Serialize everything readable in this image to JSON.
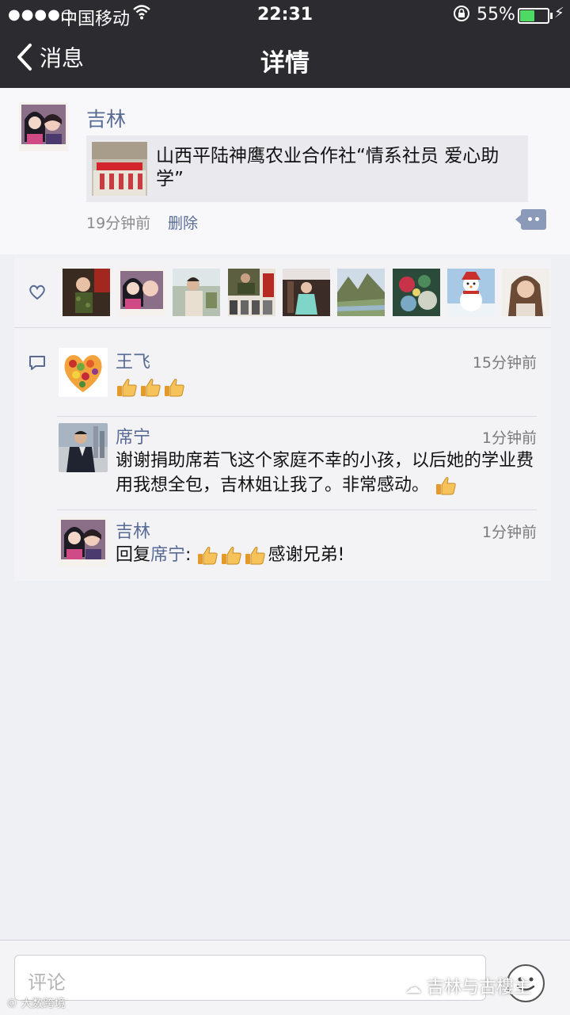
{
  "status_bar": {
    "carrier": "中国移动",
    "time": "22:31",
    "battery": "55%"
  },
  "nav": {
    "back_label": "消息",
    "title": "详情"
  },
  "post": {
    "author": "吉林",
    "link_text": "山西平陆神鹰农业合作社“情系社员 爱心助学”",
    "time": "19分钟前",
    "delete_label": "删除"
  },
  "likes": {
    "count_shown": 9
  },
  "comments": [
    {
      "name": "王飞",
      "time": "15分钟前"
    },
    {
      "name": "席宁",
      "time": "1分钟前",
      "text": "谢谢捐助席若飞这个家庭不幸的小孩，以后她的学业费用我想全包，吉林姐让我了。非常感动。"
    },
    {
      "name": "吉林",
      "time": "1分钟前",
      "reply_prefix": "回复",
      "reply_to": "席宁",
      "colon": ":",
      "text": "感谢兄弟!"
    }
  ],
  "input": {
    "placeholder": "评论"
  },
  "watermark": {
    "main": "吉林与古樓主",
    "small": "大数跨境"
  },
  "colors": {
    "nav_bg": "#2c2c30",
    "link_blue": "#586b95",
    "battery_green": "#4cd964"
  }
}
